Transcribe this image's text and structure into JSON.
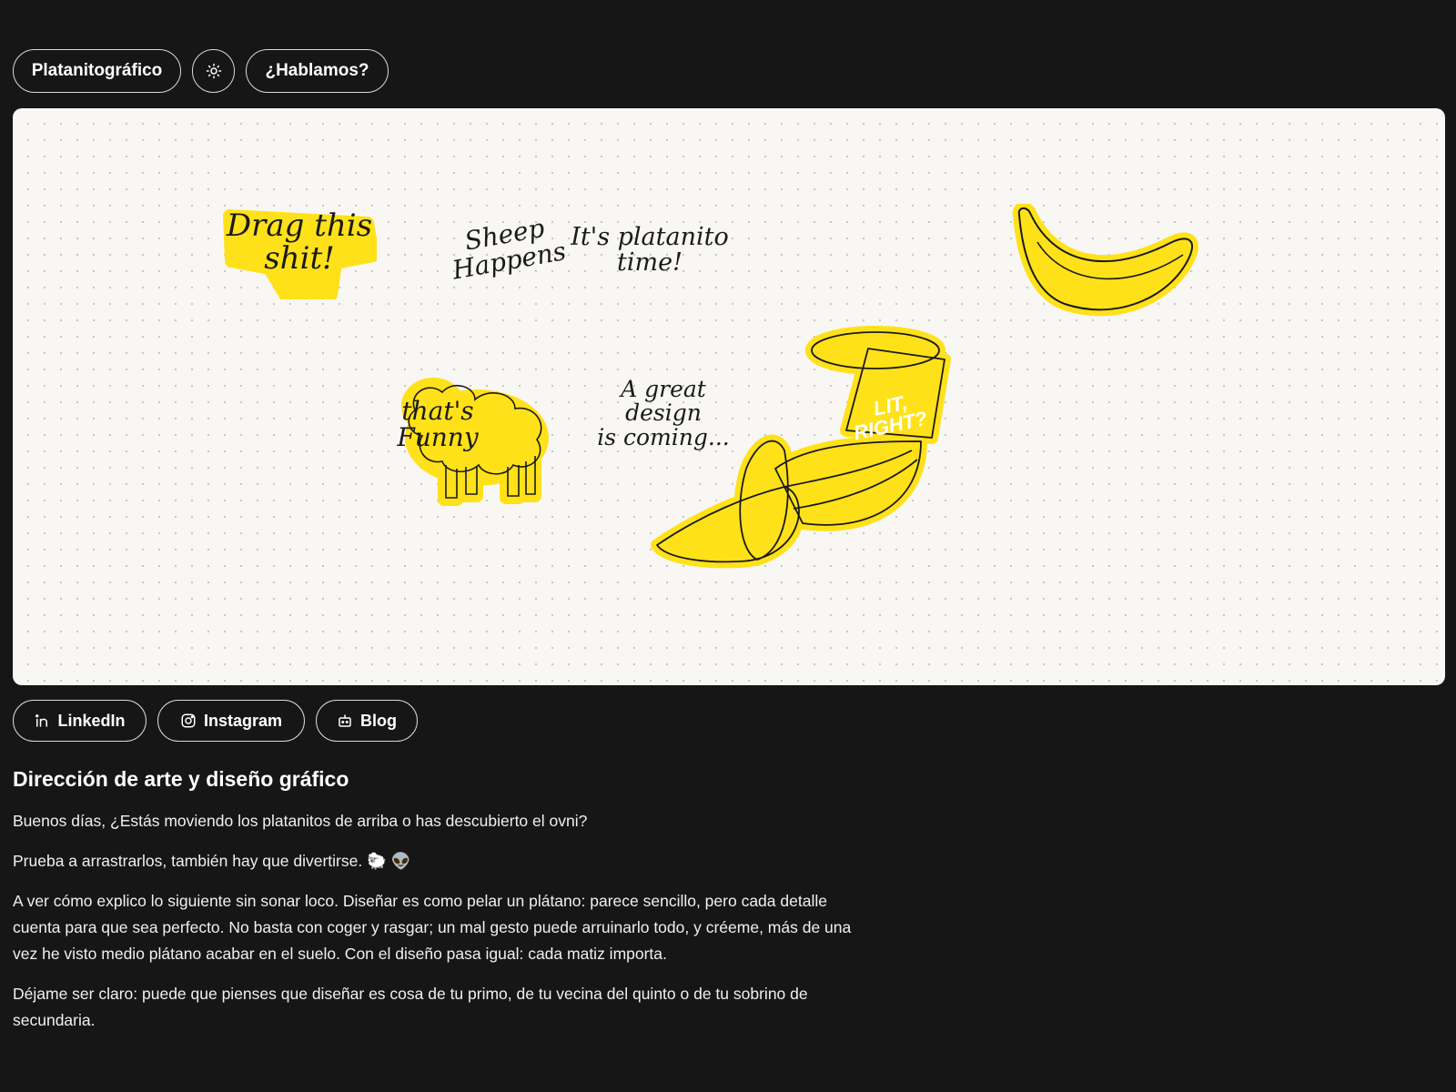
{
  "header": {
    "brand_label": "Platanitográfico",
    "theme_toggle_icon": "sun-icon",
    "contact_label": "¿Hablamos?"
  },
  "canvas": {
    "background": "#f8f7f4",
    "sticker_color": "#ffe11a",
    "stickers": {
      "drag": "Drag this\nshit!",
      "sheep_happens": "Sheep\nHappens",
      "platanito_time": "It's platanito\ntime!",
      "thats_funny": "that's\nFunny",
      "great_design": "A great\ndesign\nis coming...",
      "ufo_label": "LIT,\nRIGHT?"
    }
  },
  "social": {
    "linkedin": "LinkedIn",
    "instagram": "Instagram",
    "blog": "Blog"
  },
  "main": {
    "title": "Dirección de arte y diseño gráfico",
    "p1": "Buenos días, ¿Estás moviendo los platanitos de arriba o has descubierto el ovni?",
    "p2": "Prueba a arrastrarlos, también hay que divertirse. 🐑 👽",
    "p3": "A ver cómo explico lo siguiente sin sonar loco. Diseñar es como pelar un plátano: parece sencillo, pero cada detalle cuenta para que sea perfecto. No basta con coger y rasgar; un mal gesto puede arruinarlo todo, y créeme, más de una vez he visto medio plátano acabar en el suelo. Con el diseño pasa igual: cada matiz importa.",
    "p4": "Déjame ser claro: puede que pienses que diseñar es cosa de tu primo, de tu vecina del quinto o de tu sobrino de secundaria."
  }
}
